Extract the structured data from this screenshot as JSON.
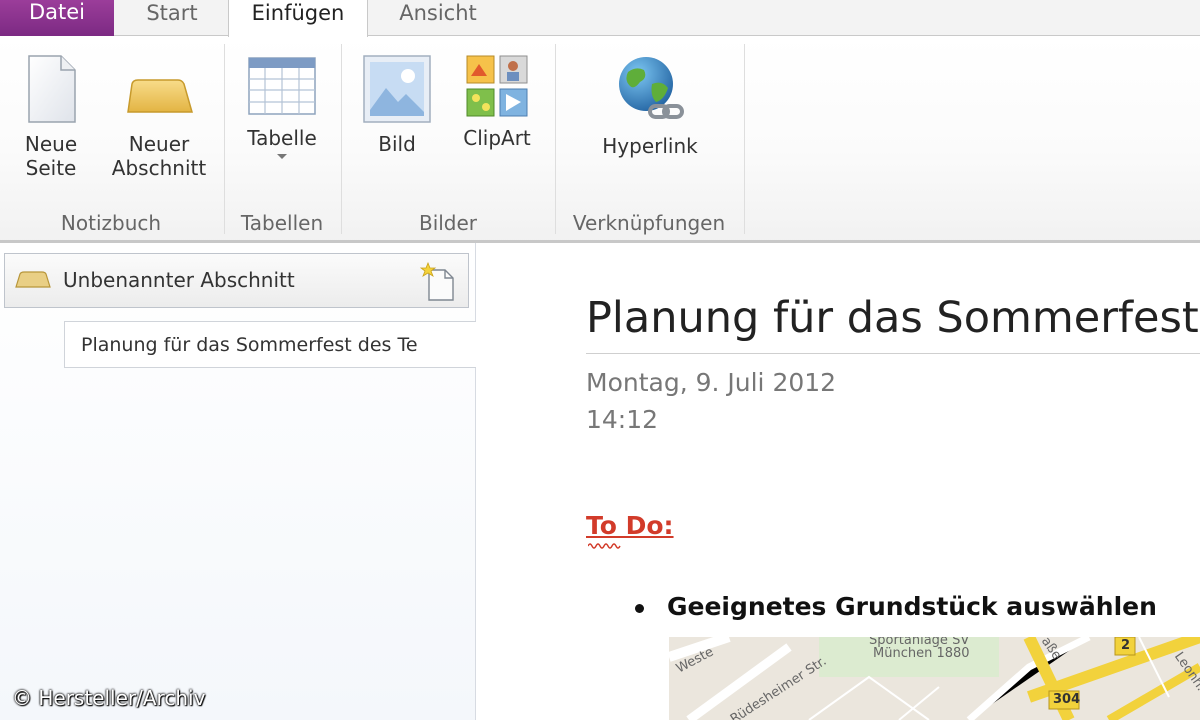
{
  "tabs": {
    "file": "Datei",
    "start": "Start",
    "insert": "Einfügen",
    "view": "Ansicht"
  },
  "ribbon": {
    "groups": {
      "notebook": "Notizbuch",
      "tables": "Tabellen",
      "images": "Bilder",
      "links": "Verknüpfungen"
    },
    "buttons": {
      "new_page": "Neue\nSeite",
      "new_section": "Neuer\nAbschnitt",
      "table": "Tabelle",
      "picture": "Bild",
      "clipart": "ClipArt",
      "hyperlink": "Hyperlink"
    }
  },
  "nav": {
    "section_label": "Unbenannter Abschnitt",
    "page_label": "Planung für das Sommerfest des Te"
  },
  "page": {
    "title": "Planung für das Sommerfest d",
    "date": "Montag, 9. Juli 2012",
    "time": "14:12",
    "todo_heading": "To Do:",
    "task_1": "Geeignetes Grundstück auswählen"
  },
  "map": {
    "label_sport": "Sportanlage SV",
    "label_club": "München 1880",
    "street_west": "Weste",
    "street_ruedesheimer": "Rüdesheimer Str.",
    "street_leonh": "Leonh.-Moll-Bog",
    "street_strasse": "aße",
    "road_2": "2",
    "road_304": "304"
  },
  "credit": "© Hersteller/Archiv",
  "colors": {
    "file_tab": "#8b3a8f",
    "todo_red": "#d23b2a",
    "map_road": "#f2d23c"
  }
}
